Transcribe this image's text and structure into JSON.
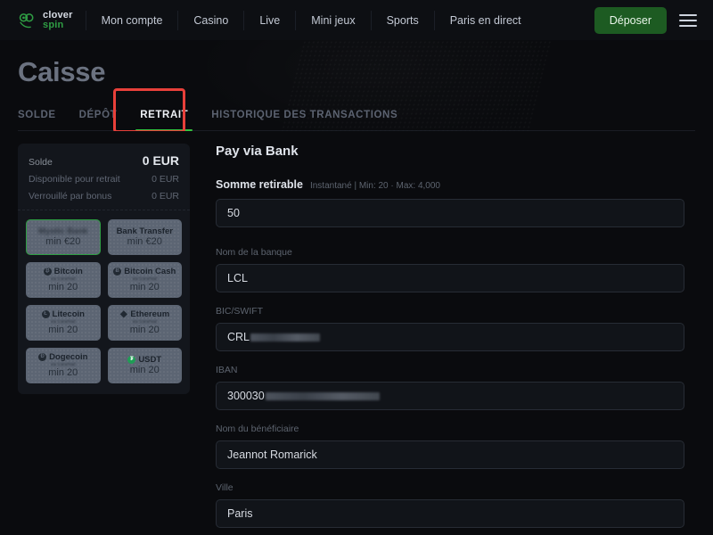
{
  "header": {
    "logo": {
      "line1": "clover",
      "line2": "spin",
      "icon": "clover-logo-icon"
    },
    "nav": [
      {
        "label": "Mon compte"
      },
      {
        "label": "Casino"
      },
      {
        "label": "Live"
      },
      {
        "label": "Mini jeux"
      },
      {
        "label": "Sports"
      },
      {
        "label": "Paris en direct"
      }
    ],
    "deposit_button": "Déposer",
    "menu_icon": "hamburger-menu-icon"
  },
  "hero": {
    "title": "Caisse",
    "tabs": [
      {
        "label": "SOLDE",
        "active": false
      },
      {
        "label": "DÉPÔT",
        "active": false
      },
      {
        "label": "RETRAIT",
        "active": true
      },
      {
        "label": "HISTORIQUE DES TRANSACTIONS",
        "active": false
      }
    ],
    "highlight_color": "#e8403a",
    "active_underline_color": "#35c13f"
  },
  "sidebar": {
    "balance": [
      {
        "label": "Solde",
        "value": "0 EUR"
      },
      {
        "label": "Disponible pour retrait",
        "value": "0 EUR"
      },
      {
        "label": "Verrouillé par bonus",
        "value": "0 EUR"
      }
    ],
    "methods": [
      {
        "brand": "Mystic Bank",
        "sub": "",
        "min": "min €20",
        "icon": "",
        "selected": true,
        "blurred": true
      },
      {
        "brand": "Bank Transfer",
        "sub": "",
        "min": "min €20",
        "icon": "",
        "selected": false,
        "blurred": false
      },
      {
        "brand": "Bitcoin",
        "sub": "via CoinsPaid",
        "min": "min 20",
        "icon": "₿",
        "selected": false,
        "blurred": false
      },
      {
        "brand": "Bitcoin Cash",
        "sub": "via CoinsPaid",
        "min": "min 20",
        "icon": "Ƀ",
        "selected": false,
        "blurred": false
      },
      {
        "brand": "Litecoin",
        "sub": "via CoinsPaid",
        "min": "min 20",
        "icon": "Ł",
        "selected": false,
        "blurred": false
      },
      {
        "brand": "Ethereum",
        "sub": "via CoinsPaid",
        "min": "min 20",
        "icon": "◆",
        "selected": false,
        "blurred": false
      },
      {
        "brand": "Dogecoin",
        "sub": "via CoinsPaid",
        "min": "min 20",
        "icon": "Ð",
        "selected": false,
        "blurred": false
      },
      {
        "brand": "USDT",
        "sub": "",
        "min": "min 20",
        "icon": "₮",
        "selected": false,
        "blurred": false
      }
    ]
  },
  "form": {
    "title": "Pay via Bank",
    "amount": {
      "label": "Somme retirable",
      "note": "Instantané | Min: 20 · Max: 4,000",
      "value": "50"
    },
    "fields": [
      {
        "label": "Nom de la banque",
        "value": "LCL",
        "redacted": false
      },
      {
        "label": "BIC/SWIFT",
        "value": "CRL",
        "redacted": true,
        "redact_width": 78
      },
      {
        "label": "IBAN",
        "value": "300030",
        "redacted": true,
        "redact_width": 128
      },
      {
        "label": "Nom du bénéficiaire",
        "value": "Jeannot Romarick",
        "redacted": false
      },
      {
        "label": "Ville",
        "value": "Paris",
        "redacted": false
      }
    ]
  }
}
